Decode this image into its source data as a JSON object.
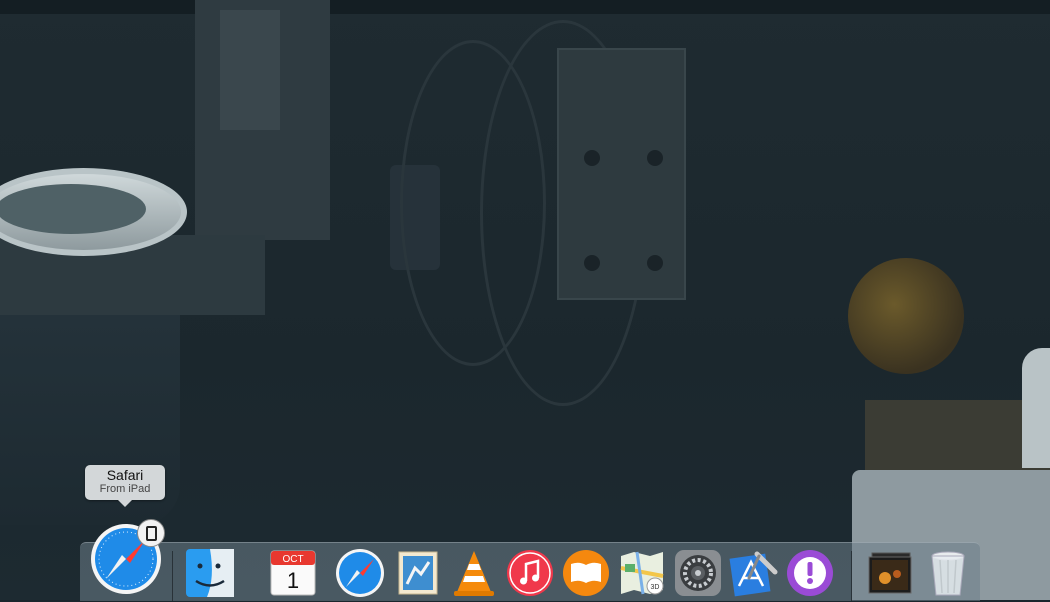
{
  "tooltip": {
    "title": "Safari",
    "subtitle": "From iPad"
  },
  "handoff": {
    "app": "safari-icon",
    "badge_icon": "ipad-icon"
  },
  "calendar": {
    "month": "OCT",
    "day": "1"
  },
  "dock": {
    "apps": [
      {
        "name": "finder-icon"
      },
      {
        "name": "calendar-icon"
      },
      {
        "name": "safari-icon"
      },
      {
        "name": "mail-icon"
      },
      {
        "name": "vlc-icon"
      },
      {
        "name": "itunes-icon"
      },
      {
        "name": "ibooks-icon"
      },
      {
        "name": "maps-icon"
      },
      {
        "name": "system-preferences-icon"
      },
      {
        "name": "xcode-icon"
      },
      {
        "name": "feedback-assistant-icon"
      },
      {
        "name": "photo-stack-icon"
      },
      {
        "name": "trash-icon"
      }
    ]
  },
  "colors": {
    "dock_bg": "#6e808a",
    "safari_blue": "#1f8be8",
    "itunes_red": "#f0384b",
    "ibooks_orange": "#f5880e",
    "feedback_purple": "#9a4bd6",
    "xcode_blue": "#2a7ee0"
  }
}
